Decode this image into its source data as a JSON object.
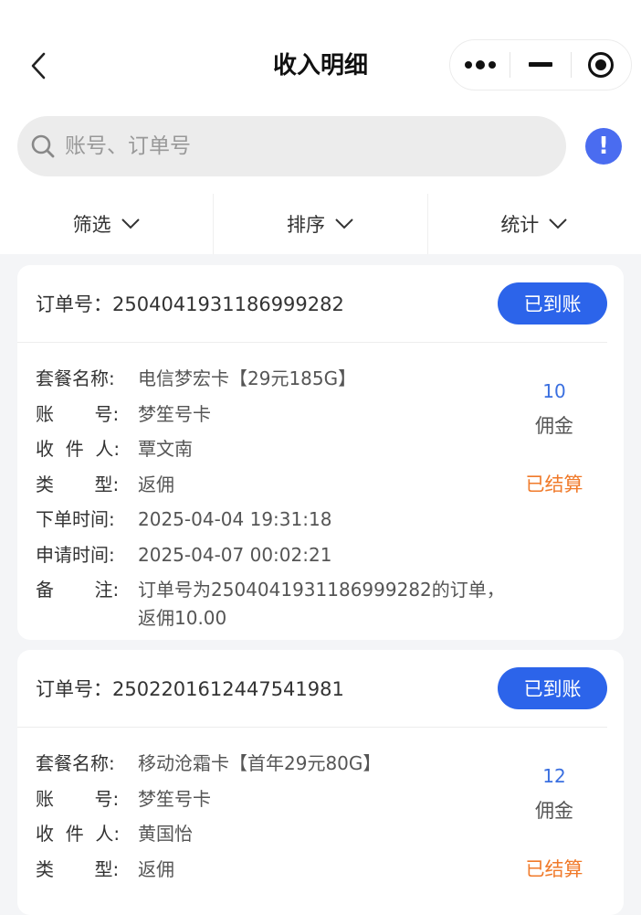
{
  "header": {
    "title": "收入明细"
  },
  "search": {
    "placeholder": "账号、订单号"
  },
  "filters": [
    {
      "label": "筛选"
    },
    {
      "label": "排序"
    },
    {
      "label": "统计"
    }
  ],
  "labels": {
    "order_no_prefix": "订单号：",
    "package": "套餐名称:",
    "account": "账       号:",
    "recipient": "收  件  人:",
    "type": "类       型:",
    "order_time": "下单时间:",
    "apply_time": "申请时间:",
    "remark": "备       注:",
    "commission": "佣金"
  },
  "orders": [
    {
      "order_no": "2504041931186999282",
      "status": "已到账",
      "package": "电信梦宏卡【29元185G】",
      "account": "梦笙号卡",
      "recipient": "覃文南",
      "type": "返佣",
      "order_time": "2025-04-04 19:31:18",
      "apply_time": "2025-04-07 00:02:21",
      "remark": "订单号为2504041931186999282的订单，返佣10.00",
      "amount": "10",
      "settle_status": "已结算"
    },
    {
      "order_no": "2502201612447541981",
      "status": "已到账",
      "package": "移动沧霜卡【首年29元80G】",
      "account": "梦笙号卡",
      "recipient": "黄国怡",
      "type": "返佣",
      "amount": "12",
      "settle_status": "已结算"
    }
  ],
  "colors": {
    "accent": "#2c64ea",
    "amount": "#3a6fe0",
    "settled": "#f07a2a",
    "alert": "#4a6cf0"
  },
  "icons": [
    "chevron-left-icon",
    "more-dots-icon",
    "minimize-icon",
    "target-icon",
    "search-icon",
    "alert-icon",
    "chevron-down-icon"
  ]
}
